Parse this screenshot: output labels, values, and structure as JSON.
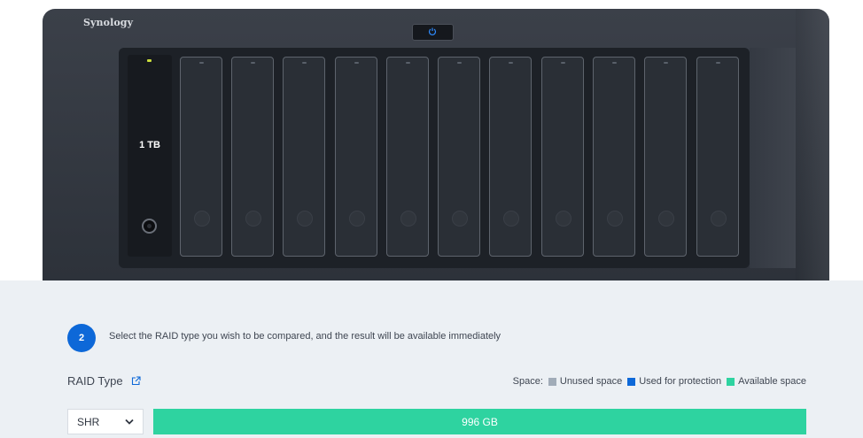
{
  "device": {
    "brand": "Synology",
    "drives": [
      {
        "capacity": "1 TB"
      }
    ]
  },
  "wizard": {
    "step_number": "2",
    "step_instruction": "Select the RAID type you wish to be compared, and the result will be available immediately",
    "raid_type_label": "RAID Type",
    "space_label": "Space:",
    "legend": [
      {
        "label": "Unused space",
        "color": "#a1acb8"
      },
      {
        "label": "Used for protection",
        "color": "#0d68d8"
      },
      {
        "label": "Available space",
        "color": "#2ed3a0"
      }
    ],
    "raid_select": {
      "value": "SHR"
    },
    "capacity_bar": {
      "available": "996 GB",
      "available_fraction": 1.0
    }
  }
}
